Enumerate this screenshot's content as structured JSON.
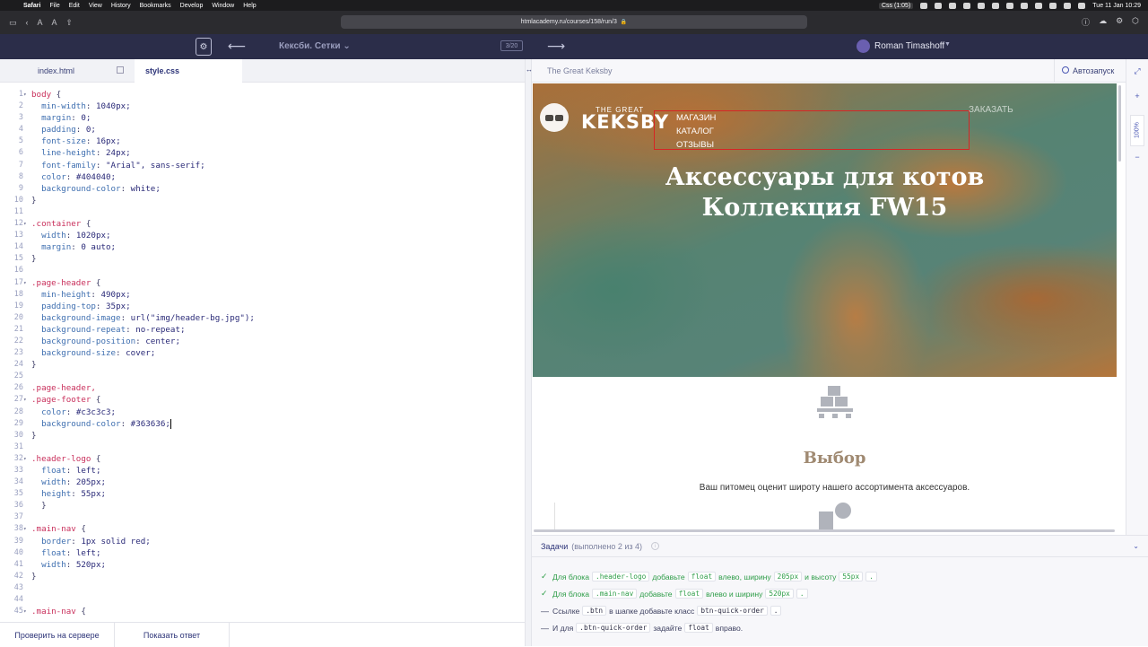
{
  "menubar": {
    "app": "Safari",
    "items": [
      "File",
      "Edit",
      "View",
      "History",
      "Bookmarks",
      "Develop",
      "Window",
      "Help"
    ],
    "status": "Css (1:05)",
    "datetime": "Tue 11 Jan  10:29"
  },
  "browser": {
    "url": "htmlacademy.ru/courses/158/run/3"
  },
  "academy": {
    "course_title": "Кексби. Сетки",
    "counter": "3/20",
    "user_name": "Roman Timashoff"
  },
  "editor": {
    "tabs": [
      {
        "label": "index.html"
      },
      {
        "label": "style.css"
      }
    ],
    "lines": [
      {
        "n": "1",
        "fold": true,
        "text": "body {"
      },
      {
        "n": "2",
        "fold": false,
        "text": "  min-width: 1040px;"
      },
      {
        "n": "3",
        "fold": false,
        "text": "  margin: 0;"
      },
      {
        "n": "4",
        "fold": false,
        "text": "  padding: 0;"
      },
      {
        "n": "5",
        "fold": false,
        "text": "  font-size: 16px;"
      },
      {
        "n": "6",
        "fold": false,
        "text": "  line-height: 24px;"
      },
      {
        "n": "7",
        "fold": false,
        "text": "  font-family: \"Arial\", sans-serif;"
      },
      {
        "n": "8",
        "fold": false,
        "text": "  color: #404040;"
      },
      {
        "n": "9",
        "fold": false,
        "text": "  background-color: white;"
      },
      {
        "n": "10",
        "fold": false,
        "text": "}"
      },
      {
        "n": "11",
        "fold": false,
        "text": ""
      },
      {
        "n": "12",
        "fold": true,
        "text": ".container {"
      },
      {
        "n": "13",
        "fold": false,
        "text": "  width: 1020px;"
      },
      {
        "n": "14",
        "fold": false,
        "text": "  margin: 0 auto;"
      },
      {
        "n": "15",
        "fold": false,
        "text": "}"
      },
      {
        "n": "16",
        "fold": false,
        "text": ""
      },
      {
        "n": "17",
        "fold": true,
        "text": ".page-header {"
      },
      {
        "n": "18",
        "fold": false,
        "text": "  min-height: 490px;"
      },
      {
        "n": "19",
        "fold": false,
        "text": "  padding-top: 35px;"
      },
      {
        "n": "20",
        "fold": false,
        "text": "  background-image: url(\"img/header-bg.jpg\");"
      },
      {
        "n": "21",
        "fold": false,
        "text": "  background-repeat: no-repeat;"
      },
      {
        "n": "22",
        "fold": false,
        "text": "  background-position: center;"
      },
      {
        "n": "23",
        "fold": false,
        "text": "  background-size: cover;"
      },
      {
        "n": "24",
        "fold": false,
        "text": "}"
      },
      {
        "n": "25",
        "fold": false,
        "text": ""
      },
      {
        "n": "26",
        "fold": false,
        "text": ".page-header,"
      },
      {
        "n": "27",
        "fold": true,
        "text": ".page-footer {"
      },
      {
        "n": "28",
        "fold": false,
        "text": "  color: #c3c3c3;"
      },
      {
        "n": "29",
        "fold": false,
        "text": "  background-color: #363636;",
        "cursor": true
      },
      {
        "n": "30",
        "fold": false,
        "text": "}"
      },
      {
        "n": "31",
        "fold": false,
        "text": ""
      },
      {
        "n": "32",
        "fold": true,
        "text": ".header-logo {"
      },
      {
        "n": "33",
        "fold": false,
        "text": "  float: left;"
      },
      {
        "n": "34",
        "fold": false,
        "text": "  width: 205px;"
      },
      {
        "n": "35",
        "fold": false,
        "text": "  height: 55px;"
      },
      {
        "n": "36",
        "fold": false,
        "text": "  }"
      },
      {
        "n": "37",
        "fold": false,
        "text": ""
      },
      {
        "n": "38",
        "fold": true,
        "text": ".main-nav {"
      },
      {
        "n": "39",
        "fold": false,
        "text": "  border: 1px solid red;"
      },
      {
        "n": "40",
        "fold": false,
        "text": "  float: left;"
      },
      {
        "n": "41",
        "fold": false,
        "text": "  width: 520px;"
      },
      {
        "n": "42",
        "fold": false,
        "text": "}"
      },
      {
        "n": "43",
        "fold": false,
        "text": ""
      },
      {
        "n": "44",
        "fold": false,
        "text": ""
      },
      {
        "n": "45",
        "fold": true,
        "text": ".main-nav {"
      }
    ],
    "footer": {
      "check_label": "Проверить на сервере",
      "answer_label": "Показать ответ"
    }
  },
  "preview": {
    "title": "The Great Keksby",
    "autorun_label": "Автозапуск",
    "zoom": "100%",
    "site": {
      "logo_small": "THE GREAT",
      "logo_big": "KEKSBY",
      "nav": [
        "МАГАЗИН",
        "КАТАЛОГ",
        "ОТЗЫВЫ"
      ],
      "order_label": "ЗАКАЗАТЬ",
      "hero_line1": "Аксессуары для котов",
      "hero_line2": "Коллекция FW15",
      "feature_title": "Выбор",
      "feature_text": "Ваш питомец оценит широту нашего ассортимента аксессуаров."
    }
  },
  "tasks": {
    "title": "Задачи",
    "progress": "(выполнено 2 из 4)",
    "items": [
      {
        "done": true,
        "parts": [
          "Для блока",
          ".header-logo",
          "добавьте",
          "float",
          "влево, ширину",
          "205px",
          "и высоту",
          "55px",
          "."
        ]
      },
      {
        "done": true,
        "parts": [
          "Для блока",
          ".main-nav",
          "добавьте",
          "float",
          "влево и ширину",
          "520px",
          "."
        ]
      },
      {
        "done": false,
        "parts": [
          "Ссылке",
          ".btn",
          "в шапке добавьте класс",
          "btn-quick-order",
          "."
        ]
      },
      {
        "done": false,
        "parts": [
          "И для",
          ".btn-quick-order",
          "задайте",
          "float",
          "вправо."
        ]
      }
    ]
  }
}
